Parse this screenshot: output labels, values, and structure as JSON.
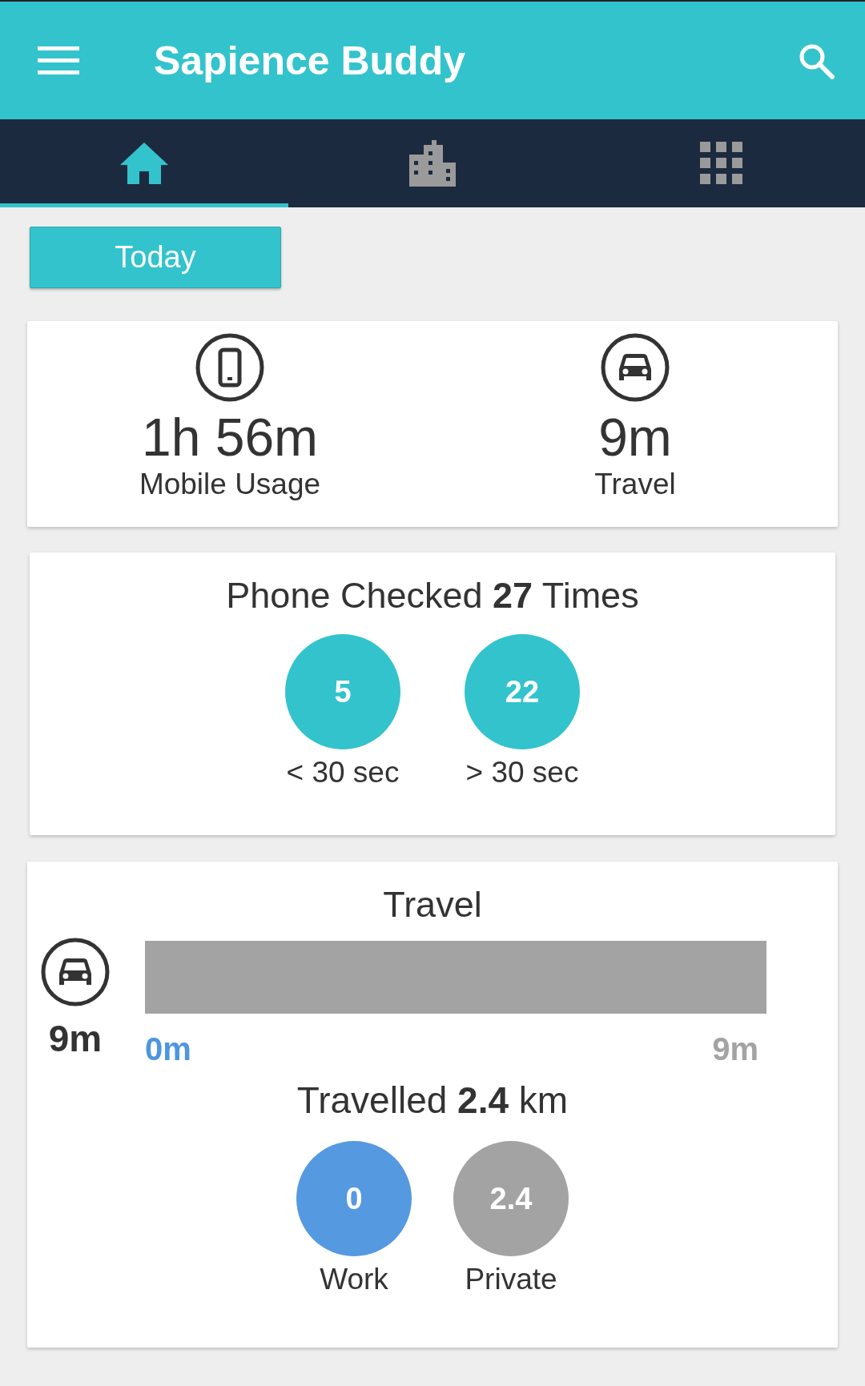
{
  "app_bar": {
    "title": "Sapience Buddy"
  },
  "tabs": [
    {
      "kind": "home",
      "selected": true
    },
    {
      "kind": "buildings",
      "selected": false
    },
    {
      "kind": "apps",
      "selected": false
    }
  ],
  "period_button": "Today",
  "summary": [
    {
      "kind": "phone",
      "value": "1h 56m",
      "label": "Mobile Usage"
    },
    {
      "kind": "car",
      "value": "9m",
      "label": "Travel"
    }
  ],
  "phone_checks": {
    "title": "Phone Checked **27** Times",
    "buckets": [
      {
        "count": "5",
        "label": "< 30 sec"
      },
      {
        "count": "22",
        "label": "> 30 sec"
      }
    ]
  },
  "travel": {
    "title": "Travel",
    "duration": "9m",
    "axis_labels": [
      {
        "text": "0m",
        "color": "#4d96e0"
      },
      {
        "text": "9m",
        "color": "#a3a3a3"
      }
    ],
    "distance": "Travelled **2.4** km",
    "split": [
      {
        "value": "0",
        "label": "Work",
        "color": "#5599e0"
      },
      {
        "value": "2.4",
        "label": "Private",
        "color": "#a3a3a3"
      }
    ]
  }
}
